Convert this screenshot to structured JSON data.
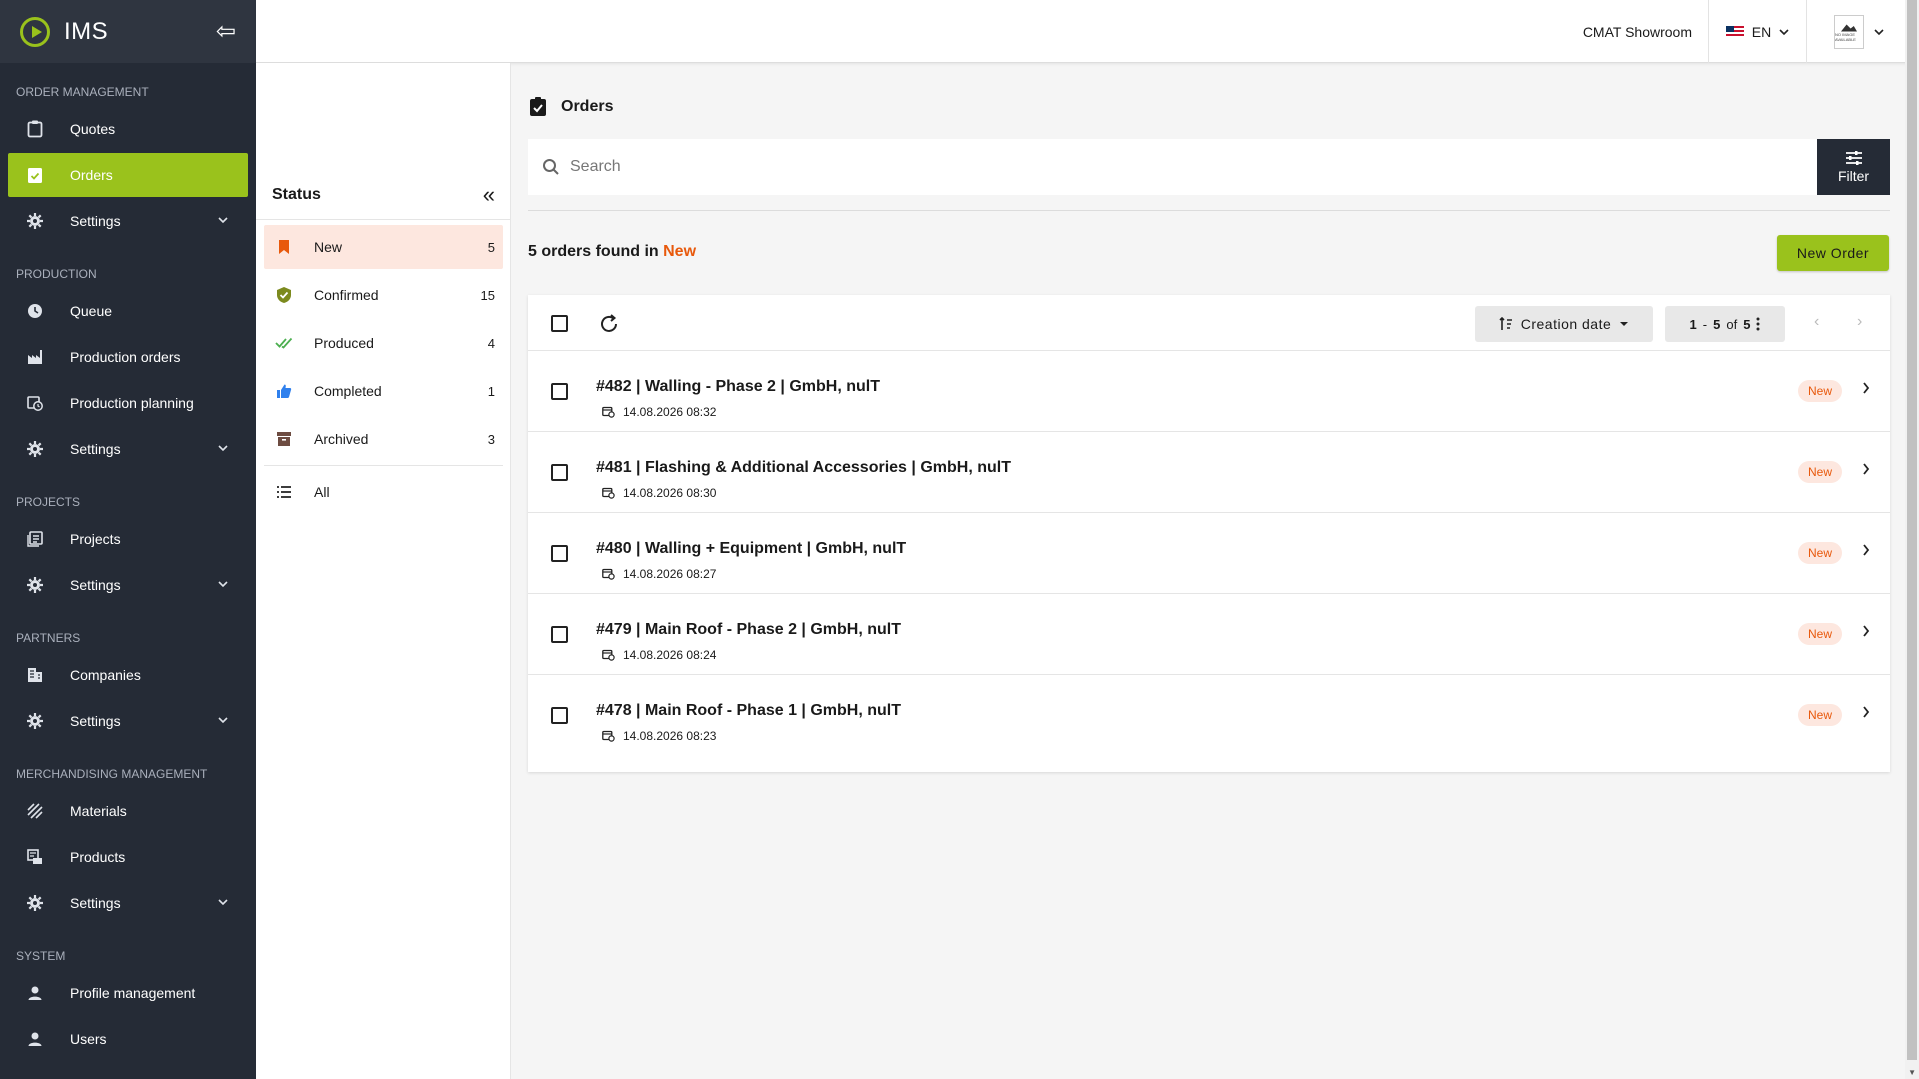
{
  "app": {
    "title": "IMS"
  },
  "sidebar": {
    "sections": [
      {
        "title": "ORDER MANAGEMENT",
        "items": [
          {
            "label": "Quotes",
            "icon": "clipboard-icon"
          },
          {
            "label": "Orders",
            "icon": "clipboard-check-icon",
            "active": true
          },
          {
            "label": "Settings",
            "icon": "gear-icon",
            "expandable": true
          }
        ]
      },
      {
        "title": "PRODUCTION",
        "items": [
          {
            "label": "Queue",
            "icon": "clock-icon"
          },
          {
            "label": "Production orders",
            "icon": "factory-icon"
          },
          {
            "label": "Production planning",
            "icon": "calendar-clock-icon"
          },
          {
            "label": "Settings",
            "icon": "gear-icon",
            "expandable": true
          }
        ]
      },
      {
        "title": "PROJECTS",
        "items": [
          {
            "label": "Projects",
            "icon": "list-box-icon"
          },
          {
            "label": "Settings",
            "icon": "gear-icon",
            "expandable": true
          }
        ]
      },
      {
        "title": "PARTNERS",
        "items": [
          {
            "label": "Companies",
            "icon": "building-icon"
          },
          {
            "label": "Settings",
            "icon": "gear-icon",
            "expandable": true
          }
        ]
      },
      {
        "title": "MERCHANDISING MANAGEMENT",
        "items": [
          {
            "label": "Materials",
            "icon": "hatch-icon"
          },
          {
            "label": "Products",
            "icon": "product-icon"
          },
          {
            "label": "Settings",
            "icon": "gear-icon",
            "expandable": true
          }
        ]
      },
      {
        "title": "SYSTEM",
        "items": [
          {
            "label": "Profile management",
            "icon": "person-icon"
          },
          {
            "label": "Users",
            "icon": "person-icon"
          }
        ]
      }
    ]
  },
  "topbar": {
    "showroom": "CMAT Showroom",
    "language": "EN",
    "avatar_text": "NO IMAGE AVAILABLE"
  },
  "status": {
    "title": "Status",
    "items": [
      {
        "label": "New",
        "count": "5",
        "active": true,
        "icon": "bookmark-icon",
        "color": "#e8590c"
      },
      {
        "label": "Confirmed",
        "count": "15",
        "icon": "shield-check-icon",
        "color": "#7c8a1e"
      },
      {
        "label": "Produced",
        "count": "4",
        "icon": "double-check-icon",
        "color": "#4caf50"
      },
      {
        "label": "Completed",
        "count": "1",
        "icon": "thumbs-up-icon",
        "color": "#2f80ed"
      },
      {
        "label": "Archived",
        "count": "3",
        "icon": "archive-icon",
        "color": "#6d4c41"
      }
    ],
    "all_label": "All"
  },
  "main": {
    "title": "Orders",
    "search_placeholder": "Search",
    "filter_label": "Filter",
    "found_prefix": "5 orders found in",
    "found_status": "New",
    "new_order_label": "New Order",
    "sort_label": "Creation date",
    "pagination": {
      "from": "1",
      "to": "5",
      "of": "of",
      "total": "5"
    },
    "orders": [
      {
        "title": "#482 | Walling - Phase 2 | GmbH, nulT",
        "date": "14.08.2026 08:32",
        "status": "New"
      },
      {
        "title": "#481 | Flashing & Additional Accessories | GmbH, nulT",
        "date": "14.08.2026 08:30",
        "status": "New"
      },
      {
        "title": "#480 | Walling + Equipment | GmbH, nulT",
        "date": "14.08.2026 08:27",
        "status": "New"
      },
      {
        "title": "#479 | Main Roof - Phase 2 | GmbH, nulT",
        "date": "14.08.2026 08:24",
        "status": "New"
      },
      {
        "title": "#478 | Main Roof - Phase 1 | GmbH, nulT",
        "date": "14.08.2026 08:23",
        "status": "New"
      }
    ]
  },
  "colors": {
    "brand": "#9ac21c",
    "sidebar": "#252b36",
    "accent": "#e8590c",
    "badge_bg": "#fde7df"
  }
}
